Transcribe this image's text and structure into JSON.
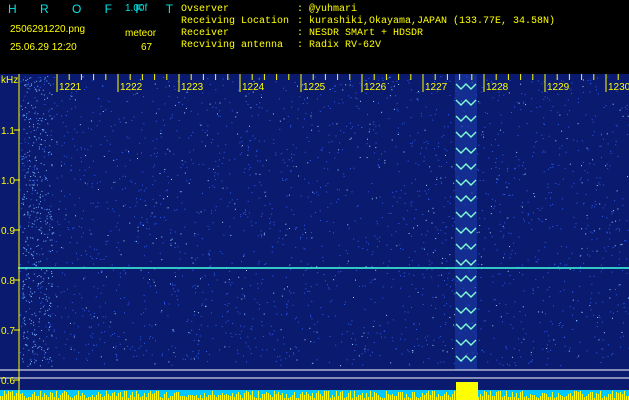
{
  "header": {
    "app_name": "H R O F F T",
    "version": "1.00f",
    "filename": "2506291220.png",
    "datetime": "25.06.29 12:20",
    "meteor_label": "meteor",
    "meteor_count": "67",
    "info_keys": [
      "Ovserver",
      "Receiving Location",
      "Receiver",
      "Recviving antenna"
    ],
    "info_values": [
      ": @yuhmari",
      ": kurashiki,Okayama,JAPAN (133.77E, 34.58N)",
      ": NESDR SMArt + HDSDR",
      ": Radix RV-62V"
    ]
  },
  "plot": {
    "y_unit": "kHz",
    "y_ticks": [
      "1.1",
      "1.0",
      "0.9",
      "0.8",
      "0.7",
      "0.6"
    ],
    "x_ticks": [
      "1221",
      "1222",
      "1223",
      "1224",
      "1225",
      "1226",
      "1227",
      "1228",
      "1229",
      "1230"
    ],
    "colors": {
      "background": "#0a1a6e",
      "noise": "#2a5cff",
      "echo": "#7fffd4",
      "carrier": "#40ffe0",
      "tick": "#ffff00",
      "marker": "#ffffff",
      "baseline": "#ffff00",
      "baseline_cyan": "#00c8ff"
    }
  }
}
